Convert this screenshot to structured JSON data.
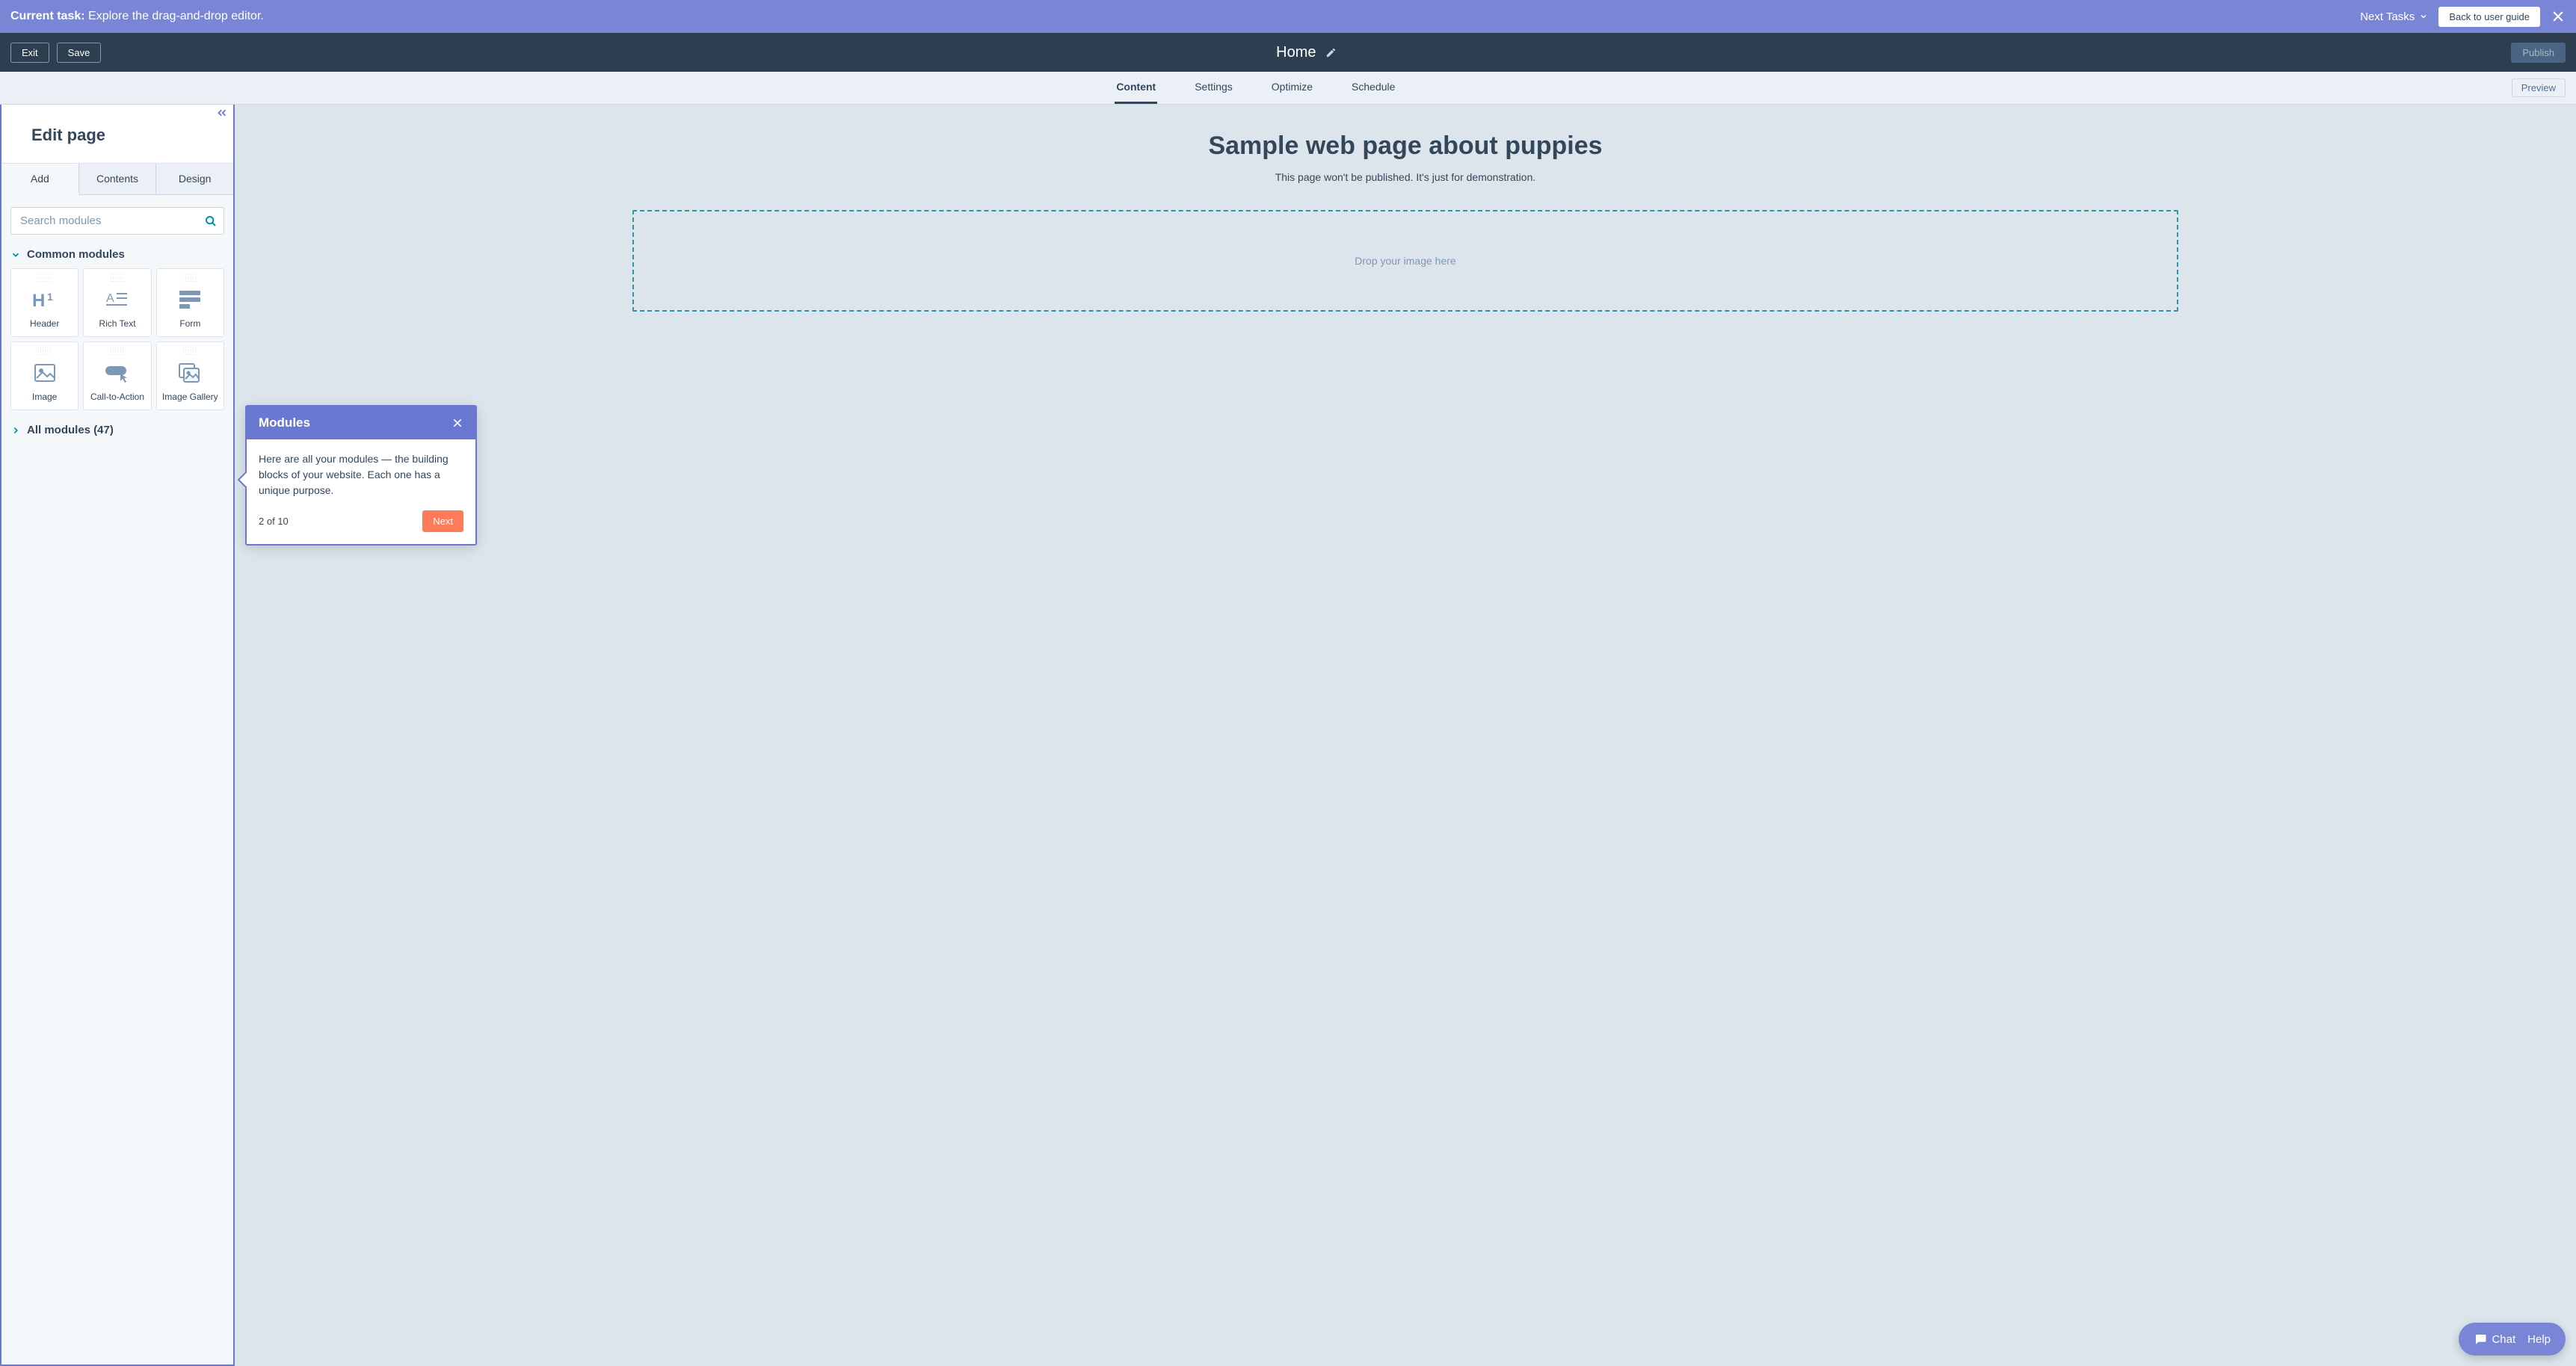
{
  "banner": {
    "task_label": "Current task:",
    "task_text": "Explore the drag-and-drop editor.",
    "next_tasks": "Next Tasks",
    "back_button": "Back to user guide"
  },
  "appbar": {
    "exit": "Exit",
    "save": "Save",
    "title": "Home",
    "publish": "Publish"
  },
  "tabs": {
    "items": [
      "Content",
      "Settings",
      "Optimize",
      "Schedule"
    ],
    "preview": "Preview"
  },
  "sidebar": {
    "title": "Edit page",
    "tabs": [
      "Add",
      "Contents",
      "Design"
    ],
    "search_placeholder": "Search modules",
    "common_header": "Common modules",
    "modules": [
      "Header",
      "Rich Text",
      "Form",
      "Image",
      "Call-to-Action",
      "Image Gallery"
    ],
    "all_modules": "All modules (47)"
  },
  "canvas": {
    "heading": "Sample web page about puppies",
    "subheading": "This page won't be published. It's just for demonstration.",
    "dropzone": "Drop your image here"
  },
  "popover": {
    "title": "Modules",
    "body": "Here are all your modules — the building blocks of your website. Each one has a unique purpose.",
    "step": "2 of 10",
    "next": "Next"
  },
  "chat": {
    "chat": "Chat",
    "help": "Help"
  }
}
